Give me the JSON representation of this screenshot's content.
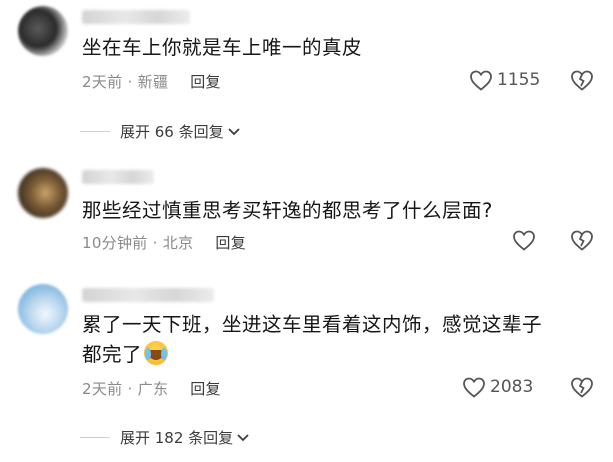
{
  "comments": [
    {
      "text": "坐在车上你就是车上唯一的真皮",
      "meta": "2天前 · 新疆",
      "reply": "回复",
      "likes": "1155",
      "expand": "展开 66 条回复"
    },
    {
      "text": "那些经过慎重思考买轩逸的都思考了什么层面?",
      "meta": "10分钟前 · 北京",
      "reply": "回复",
      "likes": "",
      "expand": ""
    },
    {
      "text_line1": "累了一天下班，坐进这车里看着这内饰，感觉这辈子",
      "text_line2": "都完了",
      "emoji": "crying-laughing-emoji",
      "meta": "2天前 · 广东",
      "reply": "回复",
      "likes": "2083",
      "expand": "展开 182 条回复"
    }
  ],
  "icons": {
    "like": "heart-outline-icon",
    "dislike": "broken-heart-icon",
    "chevron": "chevron-down-icon"
  },
  "colors": {
    "text": "#161616",
    "meta": "#8a8a8a",
    "icon": "#555555"
  }
}
